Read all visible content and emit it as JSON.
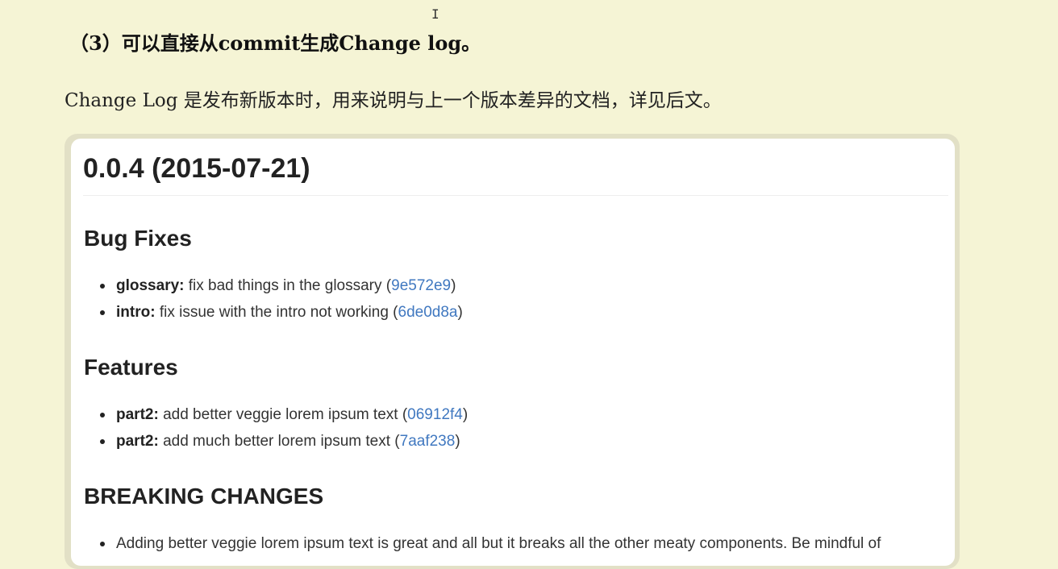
{
  "doc": {
    "heading": "（3）可以直接从commit生成Change log。",
    "intro": "Change Log 是发布新版本时，用来说明与上一个版本差异的文档，详见后文。"
  },
  "changelog": {
    "version_title": "0.0.4 (2015-07-21)",
    "sections": {
      "bug_fixes": {
        "title": "Bug Fixes",
        "items": [
          {
            "scope": "glossary:",
            "text": " fix bad things in the glossary (",
            "hash": "9e572e9",
            "close": ")"
          },
          {
            "scope": "intro:",
            "text": " fix issue with the intro not working (",
            "hash": "6de0d8a",
            "close": ")"
          }
        ]
      },
      "features": {
        "title": "Features",
        "items": [
          {
            "scope": "part2:",
            "text": " add better veggie lorem ipsum text (",
            "hash": "06912f4",
            "close": ")"
          },
          {
            "scope": "part2:",
            "text": " add much better lorem ipsum text (",
            "hash": "7aaf238",
            "close": ")"
          }
        ]
      },
      "breaking": {
        "title": "BREAKING CHANGES",
        "items": [
          {
            "text": "Adding better veggie lorem ipsum text is great and all but it breaks all the other meaty components. Be mindful of"
          }
        ]
      }
    }
  },
  "icons": {
    "text_cursor": "I"
  }
}
